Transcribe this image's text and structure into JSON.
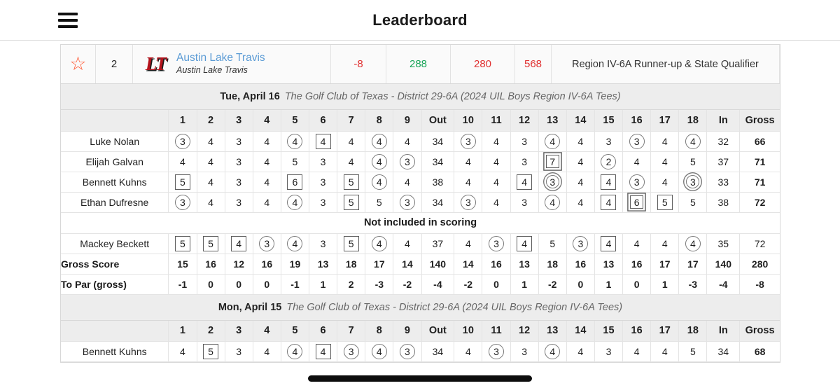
{
  "header": {
    "title": "Leaderboard",
    "menu_icon": "hamburger-menu-icon"
  },
  "team": {
    "star_icon": "star-outline-icon",
    "rank": "2",
    "logo_text": "LT",
    "name": "Austin Lake Travis",
    "subtitle": "Austin Lake Travis",
    "to_par": "-8",
    "today": "288",
    "prev": "280",
    "total": "568",
    "note": "Region IV-6A Runner-up & State Qualifier",
    "colors": {
      "star": "#ff5a36",
      "name_link": "#5b9bd5",
      "red": "#e03131",
      "green": "#18a558"
    }
  },
  "columns": [
    "",
    "1",
    "2",
    "3",
    "4",
    "5",
    "6",
    "7",
    "8",
    "9",
    "Out",
    "10",
    "11",
    "12",
    "13",
    "14",
    "15",
    "16",
    "17",
    "18",
    "In",
    "Gross"
  ],
  "rounds": [
    {
      "date": "Tue, April 16",
      "course": "The Golf Club of Texas - District 29-6A (2024 UIL Boys Region IV-6A Tees)",
      "players": [
        {
          "name": "Luke Nolan",
          "scores": [
            "3",
            "4",
            "3",
            "4",
            "4",
            "4",
            "4",
            "4",
            "4",
            "34",
            "3",
            "4",
            "3",
            "4",
            "4",
            "3",
            "3",
            "4",
            "4",
            "32",
            "66"
          ],
          "marks": [
            "circle",
            "",
            "",
            "",
            "circle",
            "square",
            "",
            "circle",
            "",
            "",
            "circle",
            "",
            "",
            "circle",
            "",
            "",
            "circle",
            "",
            "circle",
            "",
            ""
          ]
        },
        {
          "name": "Elijah Galvan",
          "scores": [
            "4",
            "4",
            "3",
            "4",
            "5",
            "3",
            "4",
            "4",
            "3",
            "34",
            "4",
            "4",
            "3",
            "7",
            "4",
            "2",
            "4",
            "4",
            "5",
            "37",
            "71"
          ],
          "marks": [
            "",
            "",
            "",
            "",
            "",
            "",
            "",
            "circle",
            "circle",
            "",
            "",
            "",
            "",
            "dsquare",
            "",
            "circle",
            "",
            "",
            "",
            "",
            ""
          ]
        },
        {
          "name": "Bennett Kuhns",
          "scores": [
            "5",
            "4",
            "3",
            "4",
            "6",
            "3",
            "5",
            "4",
            "4",
            "38",
            "4",
            "4",
            "4",
            "3",
            "4",
            "4",
            "3",
            "4",
            "3",
            "33",
            "71"
          ],
          "marks": [
            "square",
            "",
            "",
            "",
            "square",
            "",
            "square",
            "circle",
            "",
            "",
            "",
            "",
            "square",
            "dcircle",
            "",
            "square",
            "circle",
            "",
            "dcircle",
            "",
            ""
          ]
        },
        {
          "name": "Ethan Dufresne",
          "scores": [
            "3",
            "4",
            "3",
            "4",
            "4",
            "3",
            "5",
            "5",
            "3",
            "34",
            "3",
            "4",
            "3",
            "4",
            "4",
            "4",
            "6",
            "5",
            "5",
            "38",
            "72"
          ],
          "marks": [
            "circle",
            "",
            "",
            "",
            "circle",
            "",
            "square",
            "",
            "circle",
            "",
            "circle",
            "",
            "",
            "circle",
            "",
            "square",
            "dsquare",
            "square",
            "",
            "",
            ""
          ]
        }
      ],
      "notice": "Not included in scoring",
      "extras": [
        {
          "name": "Mackey Beckett",
          "scores": [
            "5",
            "5",
            "4",
            "3",
            "4",
            "3",
            "5",
            "4",
            "4",
            "37",
            "4",
            "3",
            "4",
            "5",
            "3",
            "4",
            "4",
            "4",
            "4",
            "35",
            "72"
          ],
          "marks": [
            "square",
            "square",
            "square",
            "circle",
            "circle",
            "",
            "square",
            "circle",
            "",
            "",
            "",
            "circle",
            "square",
            "",
            "circle",
            "square",
            "",
            "",
            "circle",
            "",
            ""
          ]
        }
      ],
      "totals": [
        {
          "label": "Gross Score",
          "values": [
            "15",
            "16",
            "12",
            "16",
            "19",
            "13",
            "18",
            "17",
            "14",
            "140",
            "14",
            "16",
            "13",
            "18",
            "16",
            "13",
            "16",
            "17",
            "17",
            "140",
            "280"
          ]
        },
        {
          "label": "To Par (gross)",
          "values": [
            "-1",
            "0",
            "0",
            "0",
            "-1",
            "1",
            "2",
            "-3",
            "-2",
            "-4",
            "-2",
            "0",
            "1",
            "-2",
            "0",
            "1",
            "0",
            "1",
            "-3",
            "-4",
            "-8"
          ]
        }
      ]
    },
    {
      "date": "Mon, April 15",
      "course": "The Golf Club of Texas - District 29-6A (2024 UIL Boys Region IV-6A Tees)",
      "players": [
        {
          "name": "Bennett Kuhns",
          "scores": [
            "4",
            "5",
            "3",
            "4",
            "4",
            "4",
            "3",
            "4",
            "3",
            "34",
            "4",
            "3",
            "3",
            "4",
            "4",
            "3",
            "4",
            "4",
            "5",
            "34",
            "68"
          ],
          "marks": [
            "",
            "square",
            "",
            "",
            "circle",
            "square",
            "circle",
            "circle",
            "circle",
            "",
            "",
            "circle",
            "",
            "circle",
            "",
            "",
            "",
            "",
            "",
            "",
            ""
          ]
        }
      ],
      "notice": "",
      "extras": [],
      "totals": []
    }
  ]
}
